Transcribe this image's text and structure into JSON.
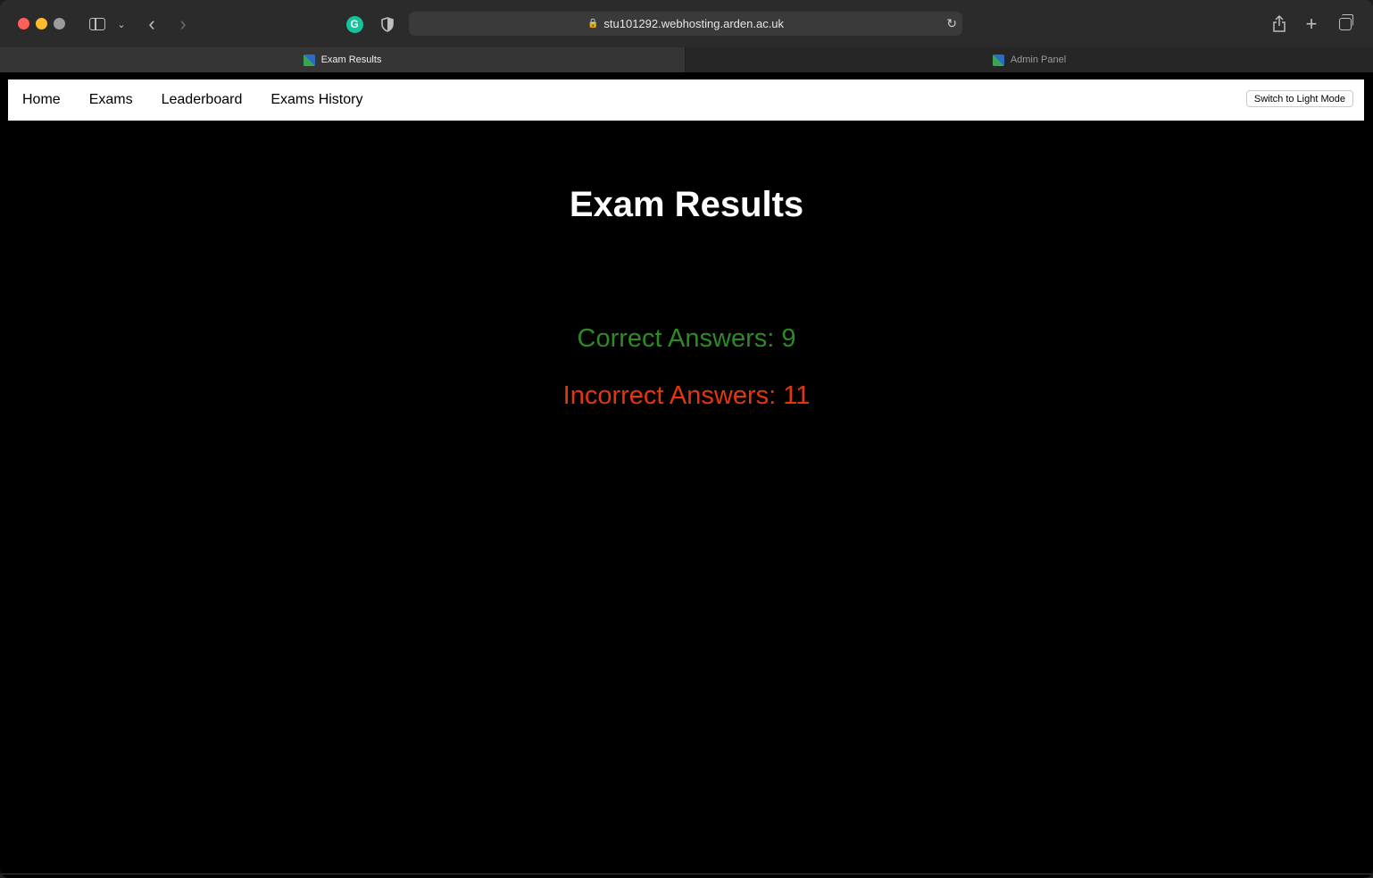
{
  "browser": {
    "url": "stu101292.webhosting.arden.ac.uk",
    "tabs": [
      {
        "label": "Exam Results",
        "active": true
      },
      {
        "label": "Admin Panel",
        "active": false
      }
    ]
  },
  "nav": {
    "links": [
      "Home",
      "Exams",
      "Leaderboard",
      "Exams History"
    ],
    "mode_button": "Switch to Light Mode"
  },
  "main": {
    "title": "Exam Results",
    "correct": "Correct Answers: 9",
    "incorrect": "Incorrect Answers: 11"
  },
  "colors": {
    "correct": "#2d8a24",
    "incorrect": "#e2360e"
  }
}
